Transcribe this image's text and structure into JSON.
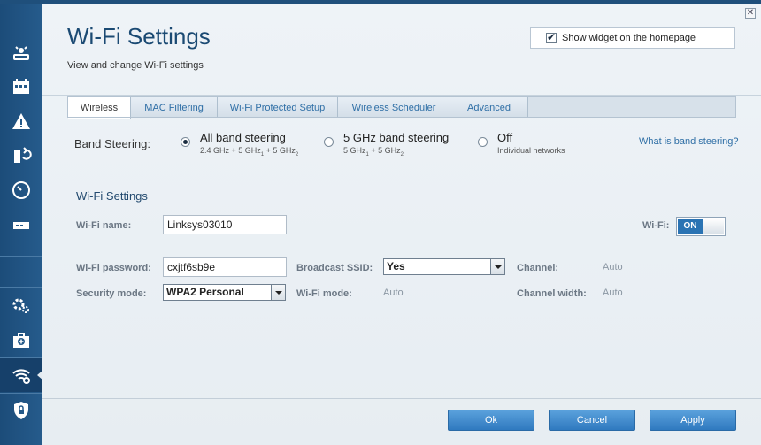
{
  "page": {
    "title": "Wi-Fi Settings",
    "subtitle": "View and change Wi-Fi settings",
    "close_glyph": "✕"
  },
  "widget": {
    "label": "Show widget on the homepage",
    "checked": true
  },
  "tabs": [
    {
      "label": "Wireless",
      "active": true
    },
    {
      "label": "MAC Filtering"
    },
    {
      "label": "Wi-Fi Protected Setup"
    },
    {
      "label": "Wireless Scheduler"
    },
    {
      "label": "Advanced"
    }
  ],
  "band_steering": {
    "label": "Band Steering:",
    "options": [
      {
        "title": "All band steering",
        "sub_html": "2.4 GHz + 5 GHz<sub>1</sub> + 5 GHz<sub>2</sub>",
        "selected": true
      },
      {
        "title": "5 GHz band steering",
        "sub_html": "5 GHz<sub>1</sub> + 5 GHz<sub>2</sub>"
      },
      {
        "title": "Off",
        "sub": "Individual networks"
      }
    ],
    "help_link": "What is band steering?"
  },
  "wifi": {
    "section_title": "Wi-Fi Settings",
    "name_label": "Wi-Fi name:",
    "name_value": "Linksys03010",
    "wifi_label": "Wi-Fi:",
    "wifi_state": "ON",
    "password_label": "Wi-Fi password:",
    "password_value": "cxjtf6sb9e",
    "broadcast_label": "Broadcast SSID:",
    "broadcast_value": "Yes",
    "channel_label": "Channel:",
    "channel_value": "Auto",
    "security_label": "Security mode:",
    "security_value": "WPA2 Personal",
    "mode_label": "Wi-Fi mode:",
    "mode_value": "Auto",
    "width_label": "Channel width:",
    "width_value": "Auto"
  },
  "footer": {
    "ok": "Ok",
    "cancel": "Cancel",
    "apply": "Apply"
  },
  "colors": {
    "accent": "#2f79bf",
    "sidebar": "#245989",
    "title": "#1b4a73",
    "link": "#2f6fa6"
  }
}
